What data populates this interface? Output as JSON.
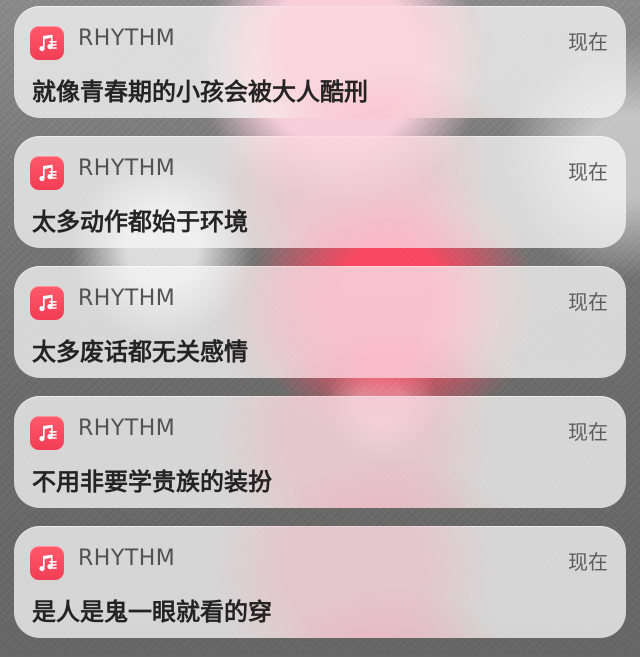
{
  "colors": {
    "card_bg": "#F5F5F5",
    "icon_red": "#F23D55",
    "text_primary": "#141414",
    "text_secondary": "#464646"
  },
  "notifications": [
    {
      "app": "RHYTHM",
      "time": "现在",
      "message": "就像青春期的小孩会被大人酷刑",
      "icon": "music-note-list-icon"
    },
    {
      "app": "RHYTHM",
      "time": "现在",
      "message": "太多动作都始于环境",
      "icon": "music-note-list-icon"
    },
    {
      "app": "RHYTHM",
      "time": "现在",
      "message": "太多废话都无关感情",
      "icon": "music-note-list-icon"
    },
    {
      "app": "RHYTHM",
      "time": "现在",
      "message": "不用非要学贵族的装扮",
      "icon": "music-note-list-icon"
    },
    {
      "app": "RHYTHM",
      "time": "现在",
      "message": "是人是鬼一眼就看的穿",
      "icon": "music-note-list-icon"
    }
  ]
}
